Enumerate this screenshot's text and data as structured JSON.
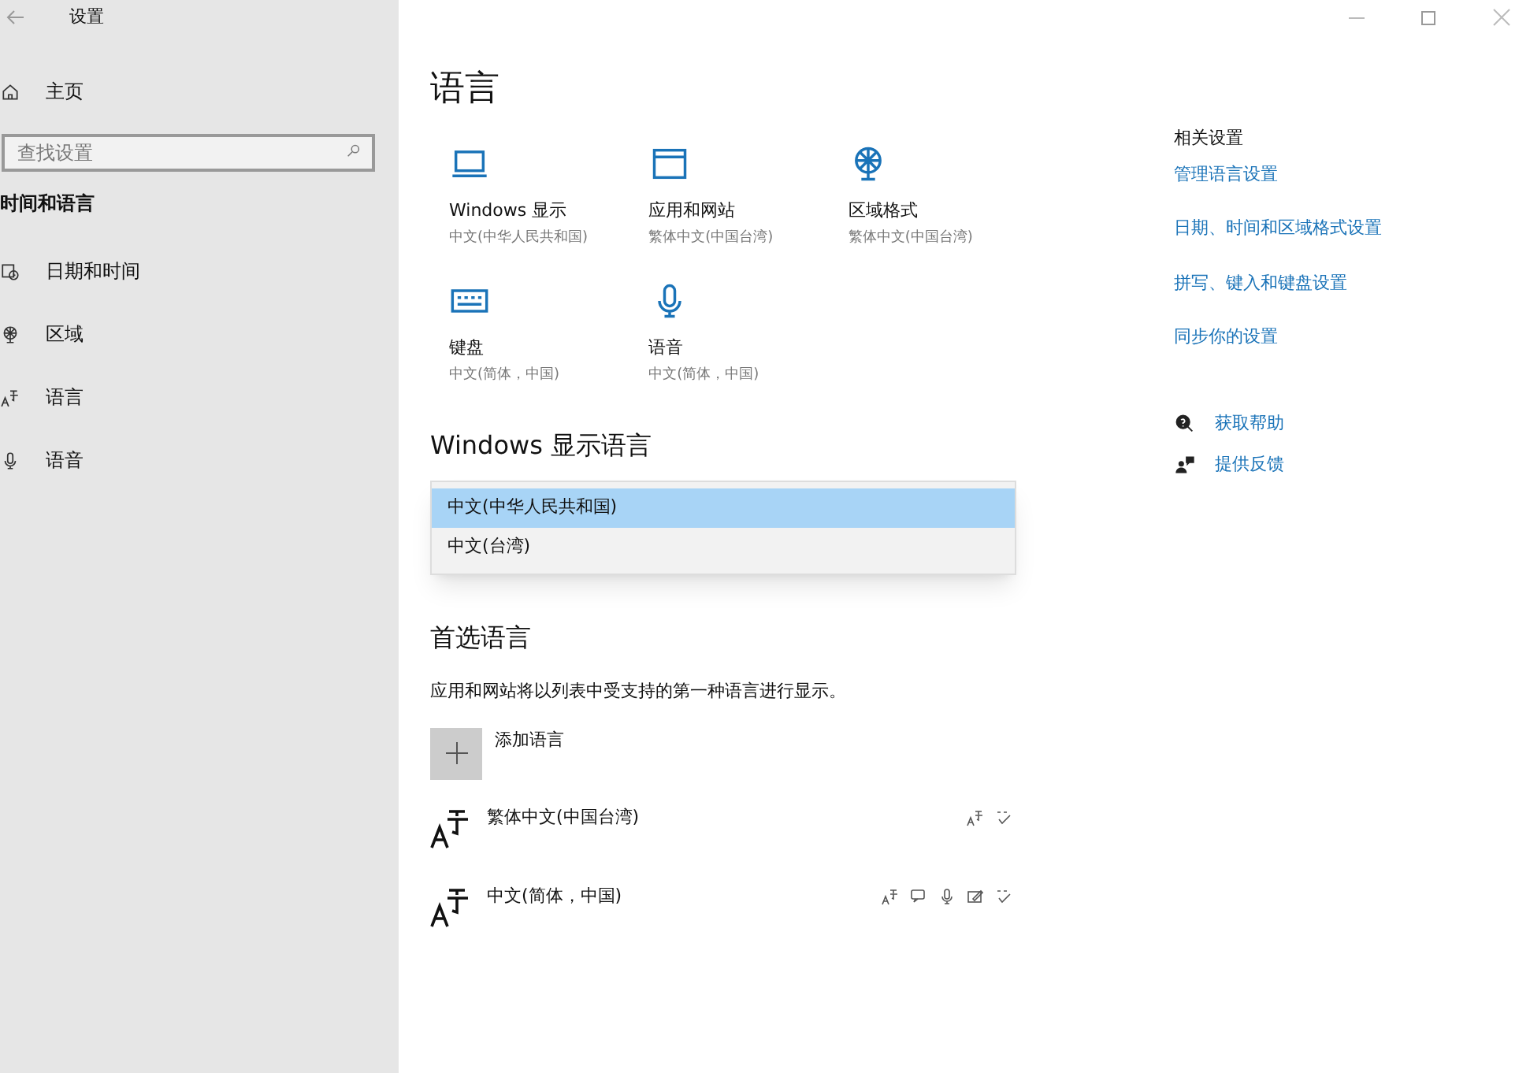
{
  "window": {
    "title": "设置"
  },
  "sidebar": {
    "home": "主页",
    "search": {
      "placeholder": "查找设置"
    },
    "section": "时间和语言",
    "items": [
      {
        "label": "日期和时间",
        "kind": "clock"
      },
      {
        "label": "区域",
        "kind": "globe"
      },
      {
        "label": "语言",
        "kind": "language"
      },
      {
        "label": "语音",
        "kind": "mic"
      }
    ]
  },
  "page_title": "语言",
  "tiles": [
    {
      "kind": "laptop",
      "title": "Windows 显示",
      "subtitle": "中文(中华人民共和国)"
    },
    {
      "kind": "window",
      "title": "应用和网站",
      "subtitle": "繁体中文(中国台湾)"
    },
    {
      "kind": "globe",
      "title": "区域格式",
      "subtitle": "繁体中文(中国台湾)"
    },
    {
      "kind": "keyboard",
      "title": "键盘",
      "subtitle": "中文(简体，中国)"
    },
    {
      "kind": "mic",
      "title": "语音",
      "subtitle": "中文(简体，中国)"
    }
  ],
  "display_language": {
    "heading": "Windows 显示语言",
    "options": [
      {
        "label": "中文(中华人民共和国)",
        "selected": true
      },
      {
        "label": "中文(台湾)",
        "selected": false
      }
    ]
  },
  "preferred": {
    "heading": "首选语言",
    "description": "应用和网站将以列表中受支持的第一种语言进行显示。",
    "add": "添加语言",
    "languages": [
      {
        "name": "繁体中文(中国台湾)",
        "features": [
          {
            "kind": "display"
          },
          {
            "kind": "spelling"
          }
        ]
      },
      {
        "name": "中文(简体，中国)",
        "features": [
          {
            "kind": "display"
          },
          {
            "kind": "speech_bubble"
          },
          {
            "kind": "mic"
          },
          {
            "kind": "handwriting"
          },
          {
            "kind": "spelling"
          }
        ]
      }
    ]
  },
  "related": {
    "heading": "相关设置",
    "links": [
      "管理语言设置",
      "日期、时间和区域格式设置",
      "拼写、键入和键盘设置",
      "同步你的设置"
    ]
  },
  "help": [
    {
      "kind": "help",
      "label": "获取帮助"
    },
    {
      "kind": "feedback",
      "label": "提供反馈"
    }
  ]
}
